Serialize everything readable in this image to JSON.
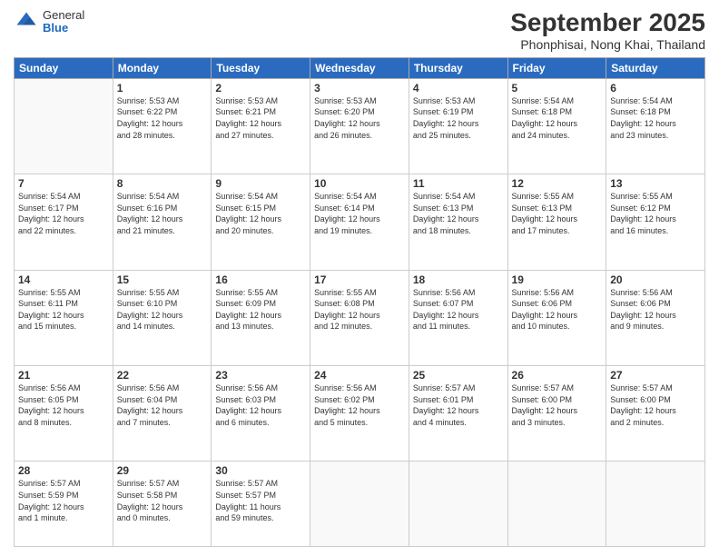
{
  "header": {
    "logo": {
      "line1": "General",
      "line2": "Blue"
    },
    "title": "September 2025",
    "subtitle": "Phonphisai, Nong Khai, Thailand"
  },
  "weekdays": [
    "Sunday",
    "Monday",
    "Tuesday",
    "Wednesday",
    "Thursday",
    "Friday",
    "Saturday"
  ],
  "weeks": [
    [
      {
        "day": "",
        "info": ""
      },
      {
        "day": "1",
        "info": "Sunrise: 5:53 AM\nSunset: 6:22 PM\nDaylight: 12 hours\nand 28 minutes."
      },
      {
        "day": "2",
        "info": "Sunrise: 5:53 AM\nSunset: 6:21 PM\nDaylight: 12 hours\nand 27 minutes."
      },
      {
        "day": "3",
        "info": "Sunrise: 5:53 AM\nSunset: 6:20 PM\nDaylight: 12 hours\nand 26 minutes."
      },
      {
        "day": "4",
        "info": "Sunrise: 5:53 AM\nSunset: 6:19 PM\nDaylight: 12 hours\nand 25 minutes."
      },
      {
        "day": "5",
        "info": "Sunrise: 5:54 AM\nSunset: 6:18 PM\nDaylight: 12 hours\nand 24 minutes."
      },
      {
        "day": "6",
        "info": "Sunrise: 5:54 AM\nSunset: 6:18 PM\nDaylight: 12 hours\nand 23 minutes."
      }
    ],
    [
      {
        "day": "7",
        "info": "Sunrise: 5:54 AM\nSunset: 6:17 PM\nDaylight: 12 hours\nand 22 minutes."
      },
      {
        "day": "8",
        "info": "Sunrise: 5:54 AM\nSunset: 6:16 PM\nDaylight: 12 hours\nand 21 minutes."
      },
      {
        "day": "9",
        "info": "Sunrise: 5:54 AM\nSunset: 6:15 PM\nDaylight: 12 hours\nand 20 minutes."
      },
      {
        "day": "10",
        "info": "Sunrise: 5:54 AM\nSunset: 6:14 PM\nDaylight: 12 hours\nand 19 minutes."
      },
      {
        "day": "11",
        "info": "Sunrise: 5:54 AM\nSunset: 6:13 PM\nDaylight: 12 hours\nand 18 minutes."
      },
      {
        "day": "12",
        "info": "Sunrise: 5:55 AM\nSunset: 6:13 PM\nDaylight: 12 hours\nand 17 minutes."
      },
      {
        "day": "13",
        "info": "Sunrise: 5:55 AM\nSunset: 6:12 PM\nDaylight: 12 hours\nand 16 minutes."
      }
    ],
    [
      {
        "day": "14",
        "info": "Sunrise: 5:55 AM\nSunset: 6:11 PM\nDaylight: 12 hours\nand 15 minutes."
      },
      {
        "day": "15",
        "info": "Sunrise: 5:55 AM\nSunset: 6:10 PM\nDaylight: 12 hours\nand 14 minutes."
      },
      {
        "day": "16",
        "info": "Sunrise: 5:55 AM\nSunset: 6:09 PM\nDaylight: 12 hours\nand 13 minutes."
      },
      {
        "day": "17",
        "info": "Sunrise: 5:55 AM\nSunset: 6:08 PM\nDaylight: 12 hours\nand 12 minutes."
      },
      {
        "day": "18",
        "info": "Sunrise: 5:56 AM\nSunset: 6:07 PM\nDaylight: 12 hours\nand 11 minutes."
      },
      {
        "day": "19",
        "info": "Sunrise: 5:56 AM\nSunset: 6:06 PM\nDaylight: 12 hours\nand 10 minutes."
      },
      {
        "day": "20",
        "info": "Sunrise: 5:56 AM\nSunset: 6:06 PM\nDaylight: 12 hours\nand 9 minutes."
      }
    ],
    [
      {
        "day": "21",
        "info": "Sunrise: 5:56 AM\nSunset: 6:05 PM\nDaylight: 12 hours\nand 8 minutes."
      },
      {
        "day": "22",
        "info": "Sunrise: 5:56 AM\nSunset: 6:04 PM\nDaylight: 12 hours\nand 7 minutes."
      },
      {
        "day": "23",
        "info": "Sunrise: 5:56 AM\nSunset: 6:03 PM\nDaylight: 12 hours\nand 6 minutes."
      },
      {
        "day": "24",
        "info": "Sunrise: 5:56 AM\nSunset: 6:02 PM\nDaylight: 12 hours\nand 5 minutes."
      },
      {
        "day": "25",
        "info": "Sunrise: 5:57 AM\nSunset: 6:01 PM\nDaylight: 12 hours\nand 4 minutes."
      },
      {
        "day": "26",
        "info": "Sunrise: 5:57 AM\nSunset: 6:00 PM\nDaylight: 12 hours\nand 3 minutes."
      },
      {
        "day": "27",
        "info": "Sunrise: 5:57 AM\nSunset: 6:00 PM\nDaylight: 12 hours\nand 2 minutes."
      }
    ],
    [
      {
        "day": "28",
        "info": "Sunrise: 5:57 AM\nSunset: 5:59 PM\nDaylight: 12 hours\nand 1 minute."
      },
      {
        "day": "29",
        "info": "Sunrise: 5:57 AM\nSunset: 5:58 PM\nDaylight: 12 hours\nand 0 minutes."
      },
      {
        "day": "30",
        "info": "Sunrise: 5:57 AM\nSunset: 5:57 PM\nDaylight: 11 hours\nand 59 minutes."
      },
      {
        "day": "",
        "info": ""
      },
      {
        "day": "",
        "info": ""
      },
      {
        "day": "",
        "info": ""
      },
      {
        "day": "",
        "info": ""
      }
    ]
  ]
}
